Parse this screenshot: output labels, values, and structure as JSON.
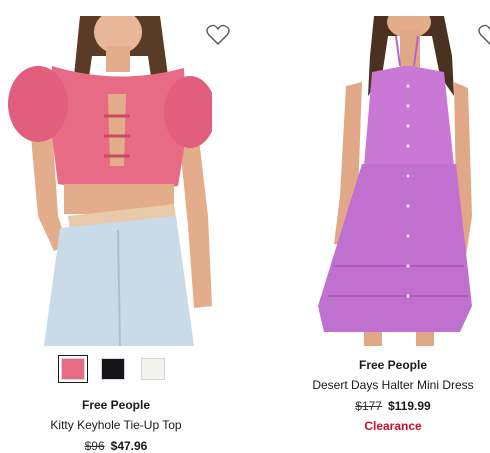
{
  "products": [
    {
      "brand": "Free People",
      "name": "Kitty Keyhole Tie-Up Top",
      "original_price": "$96",
      "sale_price": "$47.96",
      "image_icon": "model-pink-top-photo",
      "swatches": [
        {
          "color": "#e86b86",
          "selected": true
        },
        {
          "color": "#15161a",
          "selected": false
        },
        {
          "color": "#f3f2ee",
          "selected": false
        }
      ]
    },
    {
      "brand": "Free People",
      "name": "Desert Days Halter Mini Dress",
      "original_price": "$177",
      "sale_price": "$119.99",
      "badge": "Clearance",
      "badge_color": "#c8102e",
      "image_icon": "model-purple-dress-photo"
    }
  ]
}
